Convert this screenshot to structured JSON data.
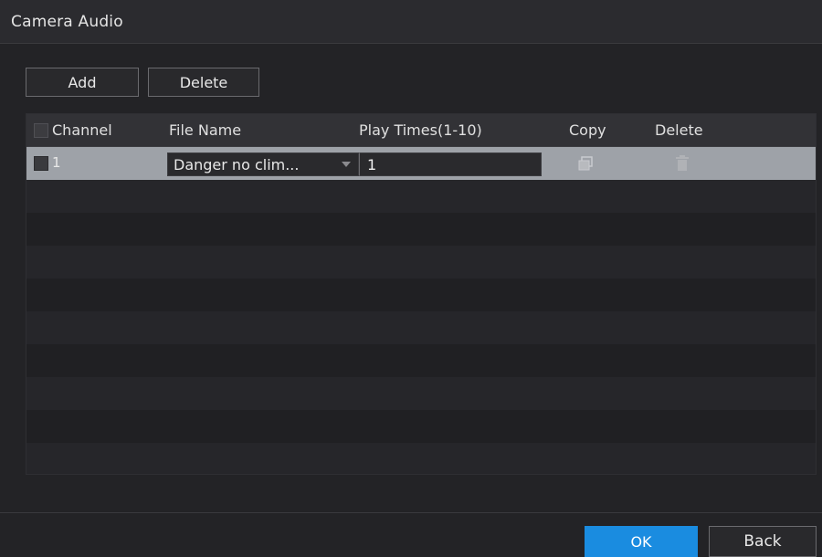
{
  "window": {
    "title": "Camera Audio"
  },
  "toolbar": {
    "add_label": "Add",
    "delete_label": "Delete"
  },
  "table": {
    "headers": {
      "channel": "Channel",
      "file_name": "File Name",
      "play_times": "Play Times(1-10)",
      "copy": "Copy",
      "delete": "Delete"
    },
    "rows": [
      {
        "channel": "1",
        "file_name": "Danger no clim...",
        "play_times": "1",
        "copy_icon": "copy-icon",
        "delete_icon": "trash-icon"
      }
    ]
  },
  "footer": {
    "ok_label": "OK",
    "back_label": "Back"
  },
  "colors": {
    "accent": "#1a8ce0",
    "selected_row": "#9ea2a8",
    "background": "#232326"
  }
}
